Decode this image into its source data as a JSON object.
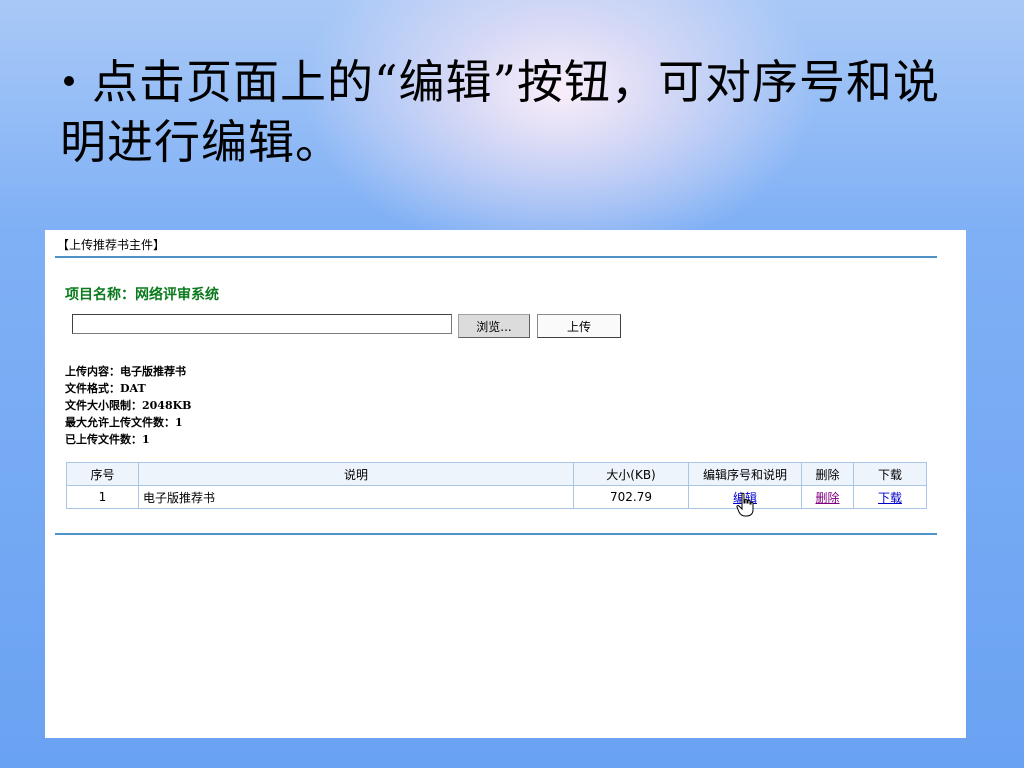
{
  "slide": {
    "bullet_text": "点击页面上的“编辑”按钮，可对序号和说明进行编辑。"
  },
  "panel": {
    "title": "【上传推荐书主件】",
    "project_name": "项目名称：网络评审系统",
    "file_input": {
      "value": "",
      "placeholder": ""
    },
    "browse_label": "浏览...",
    "upload_label": "上传",
    "info": {
      "content": "上传内容：电子版推荐书",
      "format": "文件格式：DAT",
      "size_limit": "文件大小限制：2048KB",
      "max_files": "最大允许上传文件数：1",
      "uploaded": "已上传文件数：1"
    },
    "table": {
      "headers": [
        "序号",
        "说明",
        "大小(KB)",
        "编辑序号和说明",
        "删除",
        "下载"
      ],
      "rows": [
        {
          "index": "1",
          "description": "电子版推荐书",
          "size": "702.79",
          "edit": "编辑",
          "delete": "删除",
          "download": "下载"
        }
      ]
    }
  },
  "colors": {
    "divider": "#4f93c6",
    "project_name": "#0a7a1e",
    "table_border": "#a9c6e6",
    "header_bg": "#eef4fc",
    "link": "#0000cc",
    "visited_link": "#800080"
  },
  "icons": {
    "cursor": "hand-pointer-icon"
  }
}
